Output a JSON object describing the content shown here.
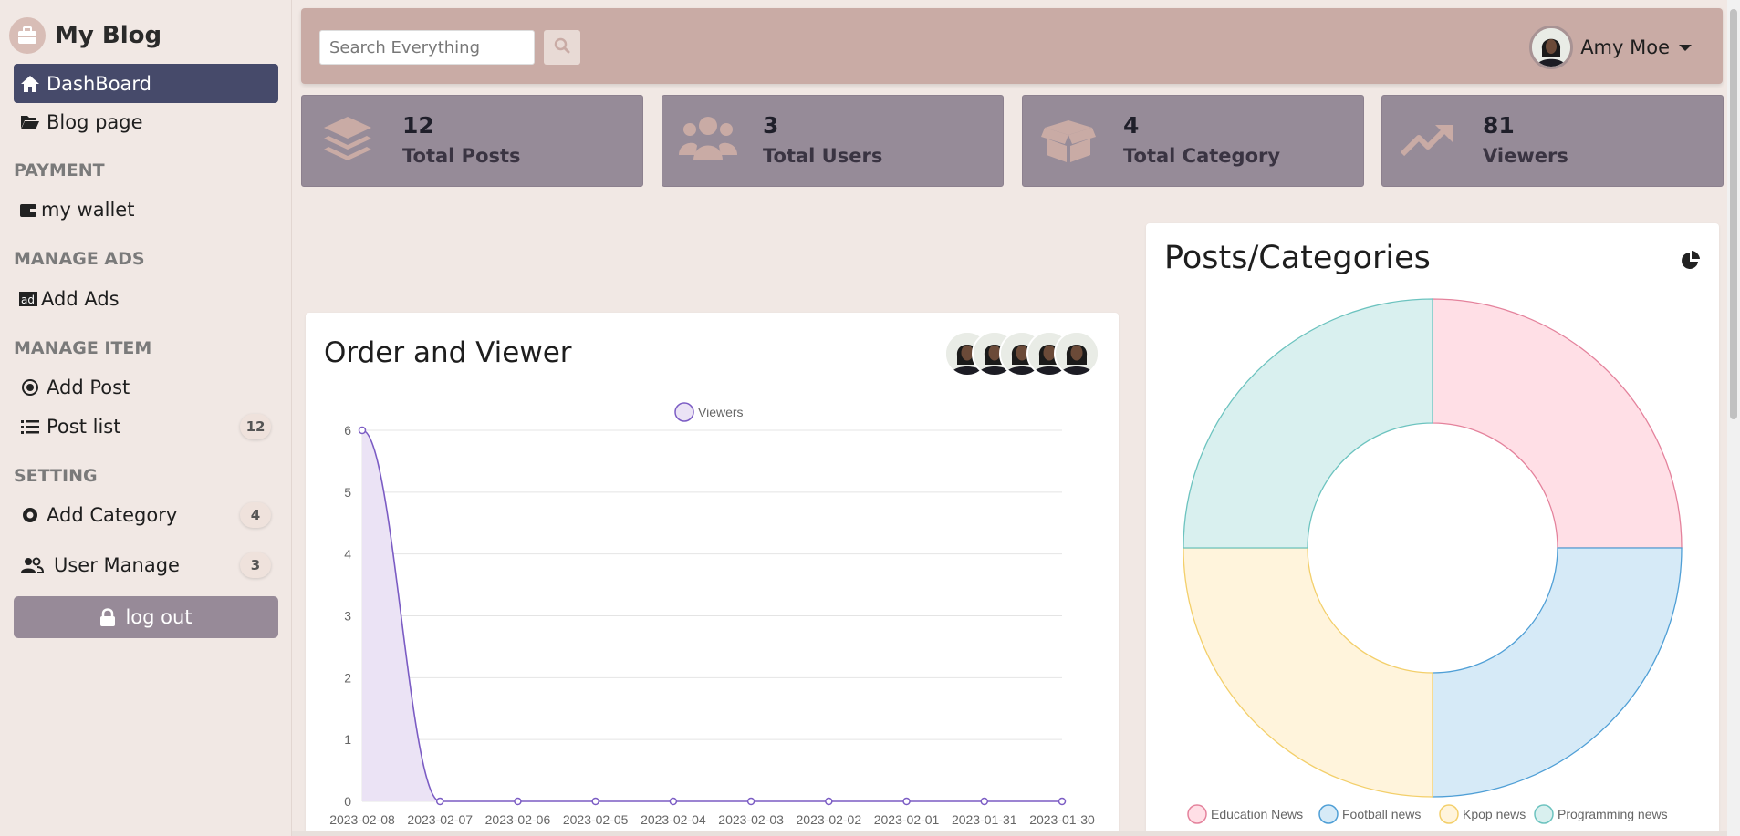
{
  "brand": {
    "title": "My Blog",
    "icon": "briefcase-icon"
  },
  "sidebar": {
    "items": [
      {
        "label": "DashBoard",
        "icon": "home-icon",
        "active": true
      },
      {
        "label": "Blog page",
        "icon": "folder-open-icon"
      }
    ],
    "sections": [
      {
        "label": "PAYMENT",
        "items": [
          {
            "label": "my wallet",
            "icon": "wallet-icon"
          }
        ]
      },
      {
        "label": "MANAGE ADS",
        "items": [
          {
            "label": "Add Ads",
            "icon": "ad-icon"
          }
        ]
      },
      {
        "label": "MANAGE ITEM",
        "items": [
          {
            "label": "Add Post",
            "icon": "dot-circle-icon"
          },
          {
            "label": "Post list",
            "icon": "list-icon",
            "badge": "12"
          }
        ]
      },
      {
        "label": "SETTING",
        "items": [
          {
            "label": "Add Category",
            "icon": "dot-circle-icon",
            "badge": "4"
          },
          {
            "label": "User Manage",
            "icon": "users-icon",
            "badge": "3"
          }
        ]
      }
    ],
    "logout_label": "log out"
  },
  "topbar": {
    "search_placeholder": "Search Everything",
    "user_name": "Amy Moe"
  },
  "stats": [
    {
      "value": "12",
      "label": "Total Posts",
      "icon": "layers-icon"
    },
    {
      "value": "3",
      "label": "Total Users",
      "icon": "users-icon"
    },
    {
      "value": "4",
      "label": "Total Category",
      "icon": "box-open-icon"
    },
    {
      "value": "81",
      "label": "Viewers",
      "icon": "trending-up-icon"
    }
  ],
  "line_panel": {
    "title": "Order and Viewer"
  },
  "pie_panel": {
    "title": "Posts/Categories"
  },
  "colors": {
    "accent": "#464a6a",
    "topbar": "#c9aba5",
    "stat_card": "#968b98",
    "line": "#7b5cc4",
    "line_fill": "#ebe3f5"
  },
  "chart_data": [
    {
      "type": "line",
      "title": "",
      "x": [
        "2023-02-08",
        "2023-02-07",
        "2023-02-06",
        "2023-02-05",
        "2023-02-04",
        "2023-02-03",
        "2023-02-02",
        "2023-02-01",
        "2023-01-31",
        "2023-01-30"
      ],
      "series": [
        {
          "name": "Viewers",
          "values": [
            6,
            0,
            0,
            0,
            0,
            0,
            0,
            0,
            0,
            0
          ],
          "color": "#7b5cc4",
          "fill": true
        }
      ],
      "ylim": [
        0,
        6
      ],
      "yticks": [
        0,
        1,
        2,
        3,
        4,
        5,
        6
      ],
      "grid": true,
      "legend": "top-center"
    },
    {
      "type": "pie",
      "title": "Posts/Categories",
      "categories": [
        "Education News",
        "Football news",
        "Kpop news",
        "Programming news"
      ],
      "values": [
        1,
        1,
        1,
        1
      ],
      "colors": [
        "#ffdfe6",
        "#d6eaf7",
        "#fff4dc",
        "#d9f0ef"
      ],
      "border_colors": [
        "#e4829c",
        "#4f9fd6",
        "#f3cf6a",
        "#6cc3bf"
      ],
      "donut": true,
      "legend": "bottom"
    }
  ]
}
